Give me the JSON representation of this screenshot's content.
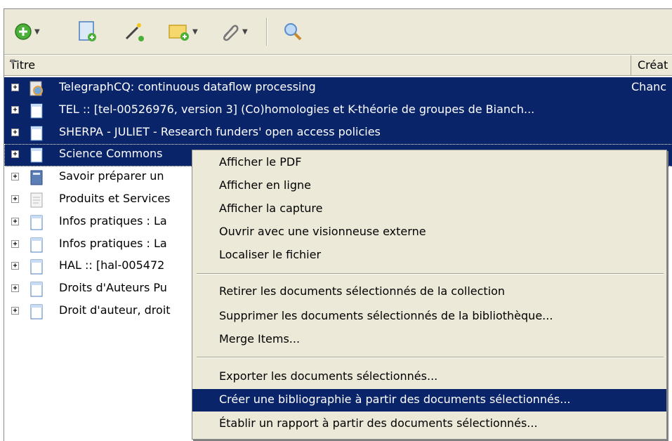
{
  "toolbar": {
    "buttons": [
      {
        "name": "new-item",
        "icon": "green-plus-icon",
        "dropdown": true
      },
      {
        "name": "new-item-from-page",
        "icon": "document-add-icon",
        "dropdown": false
      },
      {
        "name": "add-by-identifier",
        "icon": "magic-wand-icon",
        "dropdown": false
      },
      {
        "name": "new-note",
        "icon": "note-add-icon",
        "dropdown": true
      },
      {
        "name": "add-attachment",
        "icon": "paperclip-icon",
        "dropdown": true
      },
      {
        "name": "advanced-search",
        "icon": "magnifier-icon",
        "dropdown": false
      }
    ]
  },
  "columns": {
    "title": "Titre",
    "creator": "Créat"
  },
  "rows": [
    {
      "title": "TelegraphCQ: continuous dataflow processing",
      "creator": "Chanc",
      "icon": "webpage-icon"
    },
    {
      "title": "TEL :: [tel-00526976, version 3] (Co)homologies et K-théorie de groupes de Bianch...",
      "creator": "",
      "icon": "document-icon"
    },
    {
      "title": "SHERPA - JULIET - Research funders' open access policies",
      "creator": "",
      "icon": "document-icon"
    },
    {
      "title": "Science Commons",
      "creator": "",
      "icon": "document-icon"
    },
    {
      "title": "Savoir préparer un",
      "creator": "",
      "icon": "book-icon"
    },
    {
      "title": "Produits et Services",
      "creator": "",
      "icon": "note-icon"
    },
    {
      "title": "Infos pratiques : La",
      "creator": "",
      "icon": "document-icon"
    },
    {
      "title": "Infos pratiques : La",
      "creator": "",
      "icon": "document-icon"
    },
    {
      "title": "HAL :: [hal-005472",
      "creator": "",
      "icon": "document-icon"
    },
    {
      "title": "Droits d'Auteurs Pu",
      "creator": "",
      "icon": "document-icon"
    },
    {
      "title": "Droit d'auteur, droit",
      "creator": "",
      "icon": "document-icon"
    }
  ],
  "expander_glyph": "+",
  "context_menu": {
    "items": [
      "Afficher le PDF",
      "Afficher en ligne",
      "Afficher la capture",
      "Ouvrir avec une visionneuse externe",
      "Localiser le fichier",
      "Retirer les documents sélectionnés de la collection",
      "Supprimer les documents sélectionnés de la bibliothèque...",
      "Merge Items...",
      "Exporter les documents sélectionnés...",
      "Créer une bibliographie à partir des documents sélectionnés...",
      "Établir un rapport à partir des documents sélectionnés..."
    ],
    "highlighted": "Créer une bibliographie à partir des documents sélectionnés..."
  },
  "colors": {
    "selection": "#0a246a",
    "toolbar": "#ece9d8"
  }
}
